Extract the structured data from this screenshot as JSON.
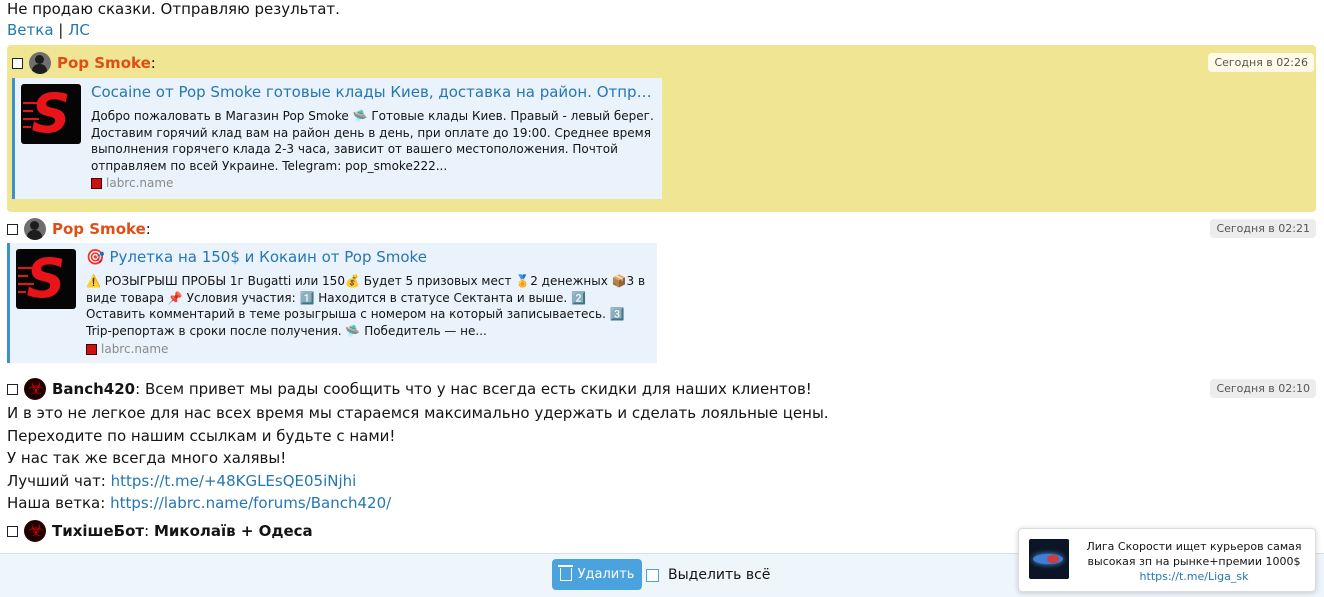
{
  "top": {
    "text": "Не продаю сказки. Отправляю результат.",
    "link_branch": "Ветка",
    "separator": "|",
    "link_pm": "ЛС"
  },
  "messages": [
    {
      "nick": "Pop Smoke",
      "colon": ":",
      "time": "Сегодня в 02:26",
      "embed": {
        "title": "Cocaine от Pop Smoke готовые клады Киев, доставка на район. Отправка почтой по Украине",
        "desc": "Добро пожаловать в Магазин Pop Smoke 🛸 Готовые клады Киев. Правый - левый берег. Доставим горячий клад вам на район день в день, при оплате до 19:00. Среднее время выполнения горячего клада 2-3 часа, зависит от вашего местоположения. Почтой отправляем по всей Украине. Telegram: pop_smoke222...",
        "site": "labrc.name"
      }
    },
    {
      "nick": "Pop Smoke",
      "colon": ":",
      "time": "Сегодня в 02:21",
      "embed": {
        "title": "🎯 Рулетка на 150$ и Кокаин от Pop Smoke",
        "desc": "⚠️ РОЗЫГРЫШ ПРОБЫ 1г Bugatti или 150💰 Будет 5 призовых мест 🏅2 денежных 📦3 в виде товара 📌 Условия участия: 1️⃣ Находится в статусе Сектанта и выше. 2️⃣ Оставить комментарий в теме розыгрыша с номером на который записываетесь. 3️⃣ Trip-репортаж в сроки после получения. 🛸 Победитель — не...",
        "site": "labrc.name"
      }
    },
    {
      "nick": "Banch420",
      "colon": ":",
      "first_line": "Всем привет мы рады сообщить что у нас всегда есть скидки для наших клиентов!",
      "time": "Сегодня в 02:10",
      "lines": [
        "И в это не легкое для нас всех время мы стараемся максимально удержать и сделать лояльные цены.",
        "Переходите по нашим ссылкам и будьте с нами!",
        "У нас так же всегда много халявы!"
      ],
      "chat_label": "Лучший чат:",
      "chat_link": "https://t.me/+48KGLEsQE05iNjhi",
      "branch_label": "Наша ветка:",
      "branch_link": "https://labrc.name/forums/Banch420/"
    },
    {
      "nick": "ТихішеБот",
      "colon": ":",
      "first_line": "Миколаїв + Одеса"
    }
  ],
  "bottom": {
    "delete_label": "Удалить",
    "select_all_label": "Выделить всё"
  },
  "toast": {
    "text": "Лига Скорости ищет курьеров самая высокая зп на рынке+премии 1000$",
    "link": "https://t.me/Liga_sk"
  }
}
